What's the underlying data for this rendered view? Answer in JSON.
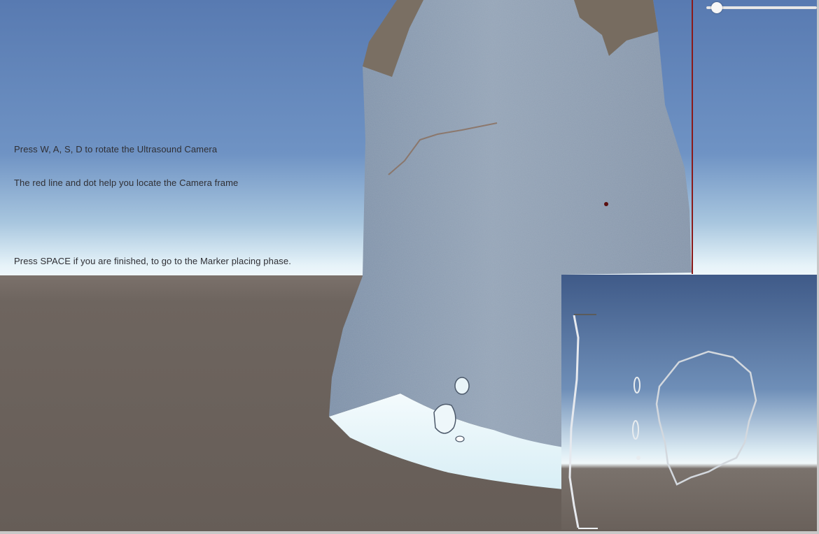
{
  "instructions": {
    "rotate": "Press W, A, S, D to rotate the Ultrasound Camera",
    "locate": "The red line and dot help you locate the Camera frame",
    "finish": "Press SPACE if you are finished, to go to the Marker placing phase."
  },
  "slider": {
    "value_fraction": 0.05
  },
  "colors": {
    "sky_top": "#5c7ab0",
    "sky_horizon": "#e6f2f8",
    "ground": "#6b625c",
    "model_surface": "#8a9bb0",
    "model_top": "#7a6f63",
    "locator": "#8b1a1a",
    "text": "#2f2f34"
  },
  "icons": {
    "slider_thumb": "circle-knob",
    "camera_dot": "red-dot"
  }
}
